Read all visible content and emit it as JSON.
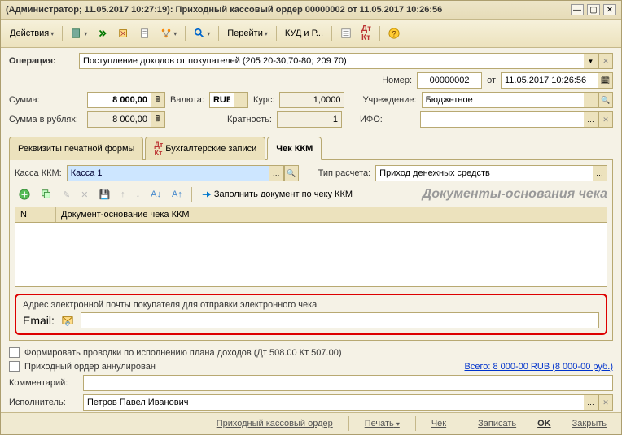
{
  "title": "(Администратор; 11.05.2017 10:27:19): Приходный кассовый ордер 00000002 от 11.05.2017 10:26:56",
  "toolbar": {
    "actions": "Действия",
    "goto": "Перейти",
    "kudir": "КУД и Р..."
  },
  "main": {
    "operation_label": "Операция:",
    "operation_value": "Поступление доходов от покупателей (205 20-30,70-80; 209 70)",
    "number_label": "Номер:",
    "number_value": "00000002",
    "from_label": "от",
    "date_value": "11.05.2017 10:26:56",
    "sum_label": "Сумма:",
    "sum_value": "8 000,00",
    "currency_label": "Валюта:",
    "currency_value": "RUB",
    "rate_label": "Курс:",
    "rate_value": "1,0000",
    "institution_label": "Учреждение:",
    "institution_value": "Бюджетное",
    "sum_rub_label": "Сумма в рублях:",
    "sum_rub_value": "8 000,00",
    "multiplicity_label": "Кратность:",
    "multiplicity_value": "1",
    "ifo_label": "ИФО:",
    "ifo_value": ""
  },
  "tabs": [
    {
      "label": "Реквизиты печатной формы"
    },
    {
      "label": "Бухгалтерские записи"
    },
    {
      "label": "Чек ККМ"
    }
  ],
  "chek": {
    "kassa_label": "Касса ККМ:",
    "kassa_value": "Касса 1",
    "tip_label": "Тип расчета:",
    "tip_value": "Приход денежных средств",
    "fill_btn": "Заполнить документ по чеку ККМ",
    "header": "Документы-основания чека",
    "col_n": "N",
    "col_doc": "Документ-основание чека ККМ"
  },
  "email": {
    "section_label": "Адрес электронной почты покупателя для отправки электронного чека",
    "label": "Email:",
    "value": ""
  },
  "checks": {
    "chk1": "Формировать проводки по исполнению плана доходов (Дт 508.00 Кт 507.00)",
    "chk2": "Приходный ордер аннулирован"
  },
  "total": "Всего: 8 000-00 RUB (8 000-00 руб.)",
  "comment_label": "Комментарий:",
  "comment_value": "",
  "executor_label": "Исполнитель:",
  "executor_value": "Петров Павел Иванович",
  "footer": {
    "order": "Приходный кассовый ордер",
    "print": "Печать",
    "chek": "Чек",
    "save": "Записать",
    "ok": "OK",
    "close": "Закрыть"
  }
}
